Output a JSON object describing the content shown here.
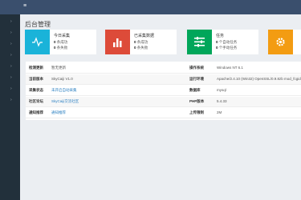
{
  "topbar": {
    "menu_glyph": "≡"
  },
  "sidebar": {
    "items": [
      "›",
      "›",
      "›",
      "›",
      "›",
      "›",
      "›",
      "›"
    ]
  },
  "page_title": "后台管理",
  "cards": [
    {
      "label": "今日采集",
      "line1_num": "0",
      "line1_text": "条成功",
      "line2_num": "0",
      "line2_text": "条失败",
      "color": "#1ab3d9",
      "icon": "pulse-icon"
    },
    {
      "label": "已采集数据",
      "line1_num": "0",
      "line1_text": "条成功",
      "line2_num": "0",
      "line2_text": "条失败",
      "color": "#dd4b39",
      "icon": "bar-chart-icon"
    },
    {
      "label": "任务",
      "line1_num": "0",
      "line1_text": "个自动任务",
      "line2_num": "0",
      "line2_text": "个手动任务",
      "color": "#00a65a",
      "icon": "tasks-icon"
    },
    {
      "label": "",
      "color": "#f39c12",
      "icon": "gear-icon"
    }
  ],
  "info_rows": [
    {
      "k1": "检测更新",
      "v1": "暂无更新",
      "k2": "操作系统",
      "v2": "Windows NT 6.1"
    },
    {
      "k1": "当前版本",
      "v1": "SkyCaiji V1.0",
      "k2": "运行环境",
      "v2": "Apache/2.4.10 (Win32) OpenSSL/0.9.8zb mod_fcgid"
    },
    {
      "k1": "采集状态",
      "v1": "未开启自动采集",
      "k2": "数据库",
      "v2": "mysql"
    },
    {
      "k1": "社区论坛",
      "v1": "SkyCaiji交流社区",
      "k2": "PHP版本",
      "v2": "5.4.33"
    },
    {
      "k1": "通知推荐",
      "v1": "通知推荐",
      "k2": "上传限制",
      "v2": "2M"
    }
  ]
}
